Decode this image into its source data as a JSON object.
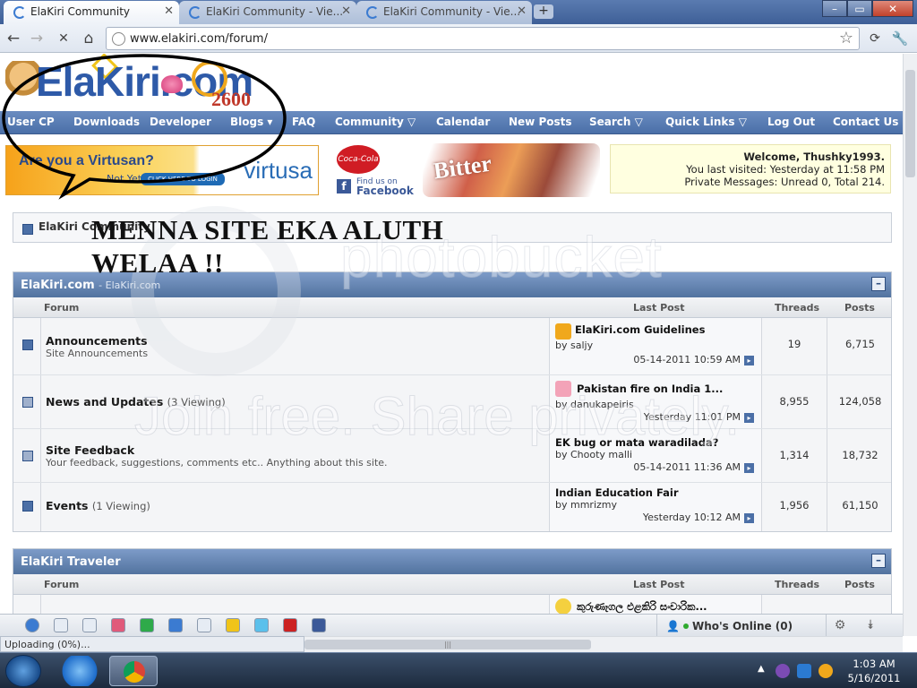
{
  "browser": {
    "tabs": [
      {
        "label": "ElaKiri Community",
        "active": true
      },
      {
        "label": "ElaKiri Community - Vie...",
        "active": false
      },
      {
        "label": "ElaKiri Community - Vie...",
        "active": false
      }
    ],
    "new_tab_glyph": "+",
    "window_buttons": {
      "minimize": "–",
      "maximize": "▭",
      "close": "✕"
    },
    "nav_glyphs": {
      "back": "←",
      "forward": "→",
      "stop": "✕",
      "home": "⌂",
      "star": "☆",
      "wrench": "🔧"
    },
    "url": "www.elakiri.com/forum/"
  },
  "logo": {
    "text": "ElaKiri.com",
    "number": "2600"
  },
  "navbar": [
    {
      "label": "User CP"
    },
    {
      "label": "Downloads"
    },
    {
      "label": "Developer"
    },
    {
      "label": "Blogs ▾"
    },
    {
      "label": "FAQ"
    },
    {
      "label": "Community ▽"
    },
    {
      "label": "Calendar"
    },
    {
      "label": "New Posts"
    },
    {
      "label": "Search ▽"
    },
    {
      "label": "Quick Links ▽"
    },
    {
      "label": "Log Out"
    },
    {
      "label": "Contact Us"
    }
  ],
  "ads": {
    "virtusa_question": "Are you a Virtusan?",
    "virtusa_sub": "Not Yet?",
    "virtusa_login": "CLICK HERE TO LOGIN",
    "virtusa_brand": "virtusa",
    "coke_logo": "Coca-Cola",
    "facebook_find": "Find us on",
    "facebook_name": "Facebook",
    "fb_glyph": "f",
    "brand_image_text": "Bitter"
  },
  "welcome": {
    "line1": "Welcome, Thushky1993.",
    "line2": "You last visited: Yesterday at 11:58 PM",
    "line3": "Private Messages: Unread 0, Total 214."
  },
  "breadcrumb_title": "ElaKiri Community",
  "overlay_text": {
    "line1": "MENNA SITE EKA ALUTH",
    "line2": "WELAA !!"
  },
  "watermark": {
    "top": "photobucket",
    "bottom": "Join free. Share privately."
  },
  "forum_sections": [
    {
      "title": "ElaKiri.com",
      "subtitle": "- ElaKiri.com",
      "columns": {
        "forum": "Forum",
        "last_post": "Last Post",
        "threads": "Threads",
        "posts": "Posts"
      },
      "rows": [
        {
          "name": "Announcements",
          "viewing": "",
          "desc": "Site Announcements",
          "lp_title": "ElaKiri.com Guidelines",
          "lp_by": "by saljy",
          "lp_date": "05-14-2011 10:59 AM",
          "threads": "19",
          "posts": "6,715"
        },
        {
          "name": "News and Updates",
          "viewing": "(3 Viewing)",
          "desc": "",
          "lp_title": "Pakistan fire on India 1...",
          "lp_by": "by danukapeiris",
          "lp_date": "Yesterday 11:01 PM",
          "threads": "8,955",
          "posts": "124,058"
        },
        {
          "name": "Site Feedback",
          "viewing": "",
          "desc": "Your feedback, suggestions, comments etc.. Anything about this site.",
          "lp_title": "EK bug or mata waradilada?",
          "lp_by": "by Chooty malli",
          "lp_date": "05-14-2011 11:36 AM",
          "threads": "1,314",
          "posts": "18,732"
        },
        {
          "name": "Events",
          "viewing": "(1 Viewing)",
          "desc": "",
          "lp_title": "Indian Education Fair",
          "lp_by": "by mmrizmy",
          "lp_date": "Yesterday 10:12 AM",
          "threads": "1,956",
          "posts": "61,150"
        }
      ]
    },
    {
      "title": "ElaKiri Traveler",
      "subtitle": "",
      "columns": {
        "forum": "Forum",
        "last_post": "Last Post",
        "threads": "Threads",
        "posts": "Posts"
      },
      "rows": [
        {
          "name": "",
          "viewing": "",
          "desc": "",
          "lp_title": "කුරුණෑගල එළකිරි සංචාරික...",
          "lp_by": "",
          "lp_date": "",
          "threads": "",
          "posts": ""
        }
      ]
    }
  ],
  "collapse_glyph": "–",
  "go_glyph": "▸",
  "whos_online": "Who's Online (0)",
  "bottom_icons": [
    "globe-icon",
    "window-icon",
    "page-icon",
    "stop-icon",
    "share-icon",
    "up-arrow-icon",
    "chat-icon",
    "radiation-icon",
    "twitter-icon",
    "youtube-icon",
    "facebook-icon"
  ],
  "bottom_glyphs": {
    "gear": "⚙",
    "collapse": "⯯"
  },
  "status": "Uploading (0%)...",
  "hscroll_grip": "|||",
  "taskbar": {
    "time": "1:03 AM",
    "date": "5/16/2011",
    "tray_arrow": "▲"
  },
  "colors": {
    "navbar": "#4a6fa8",
    "forum_header": "#52739f",
    "welcome_bg": "#ffffe0",
    "title_bar": "#3e5f97"
  }
}
